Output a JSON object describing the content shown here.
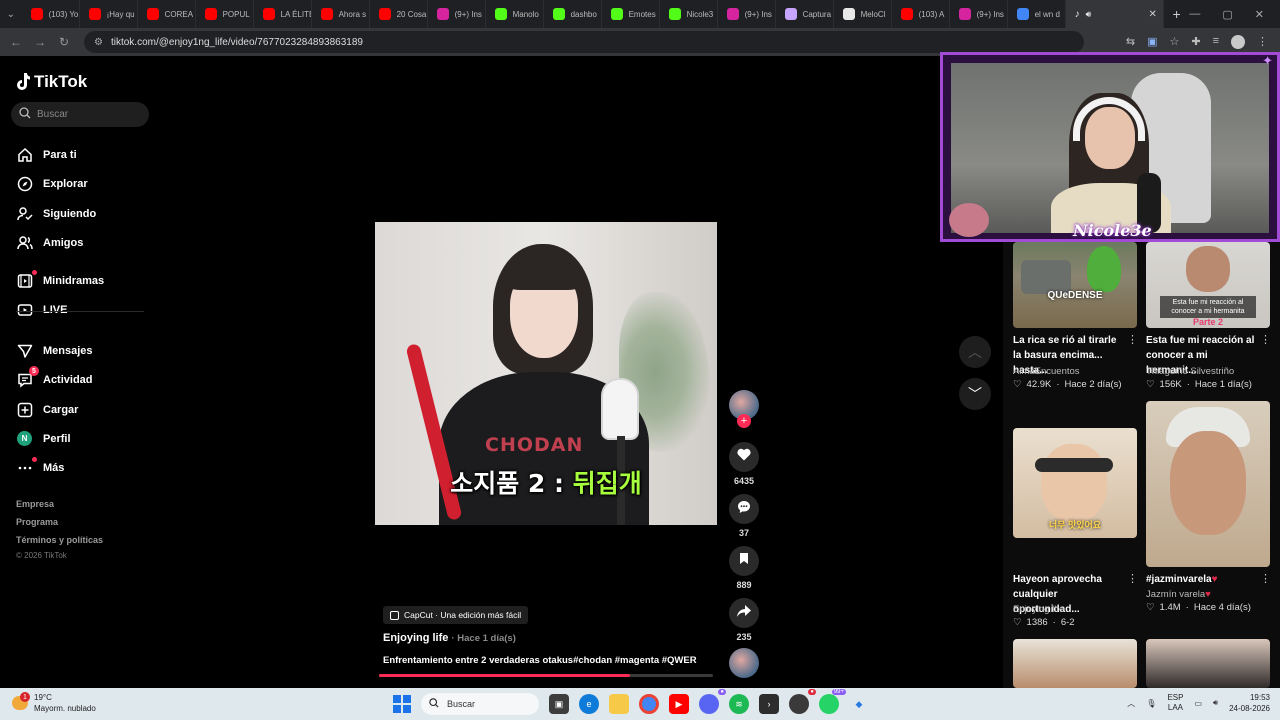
{
  "browser": {
    "tabs": [
      {
        "label": "(103) Yo",
        "icon": "youtube-icon",
        "color": "#ff0000"
      },
      {
        "label": "¡Hay qu",
        "icon": "youtube-icon",
        "color": "#ff0000"
      },
      {
        "label": "COREA",
        "icon": "youtube-icon",
        "color": "#ff0000"
      },
      {
        "label": "POPUL",
        "icon": "youtube-icon",
        "color": "#ff0000"
      },
      {
        "label": "LA ÉLITE",
        "icon": "youtube-icon",
        "color": "#ff0000"
      },
      {
        "label": "Ahora s",
        "icon": "youtube-icon",
        "color": "#ff0000"
      },
      {
        "label": "20 Cosa",
        "icon": "youtube-icon",
        "color": "#ff0000"
      },
      {
        "label": "(9+) Ins",
        "icon": "instagram-icon",
        "color": "#d6249f"
      },
      {
        "label": "Manolo",
        "icon": "kick-icon",
        "color": "#53fc18"
      },
      {
        "label": "dashbo",
        "icon": "kick-icon",
        "color": "#53fc18"
      },
      {
        "label": "Emotes",
        "icon": "kick-icon",
        "color": "#53fc18"
      },
      {
        "label": "Nicole3",
        "icon": "kick-icon",
        "color": "#53fc18"
      },
      {
        "label": "(9+) Ins",
        "icon": "instagram-icon",
        "color": "#d6249f"
      },
      {
        "label": "Captura",
        "icon": "pen-icon",
        "color": "#c6a4ff"
      },
      {
        "label": "MeloCl",
        "icon": "mail-icon",
        "color": "#e8e8e8"
      },
      {
        "label": "(103) A",
        "icon": "youtube-icon",
        "color": "#ff0000"
      },
      {
        "label": "(9+) Ins",
        "icon": "instagram-icon",
        "color": "#d6249f"
      },
      {
        "label": "el wn d",
        "icon": "google-icon",
        "color": "#4285f4"
      }
    ],
    "active_tab_icon": "tiktok-icon",
    "url": "tiktok.com/@enjoy1ng_life/video/7677023284893863189"
  },
  "sidebar": {
    "brand": "TikTok",
    "search_placeholder": "Buscar",
    "nav": [
      {
        "label": "Para ti",
        "icon": "home-icon"
      },
      {
        "label": "Explorar",
        "icon": "compass-icon"
      },
      {
        "label": "Siguiendo",
        "icon": "following-icon"
      },
      {
        "label": "Amigos",
        "icon": "friends-icon"
      },
      {
        "label": "Minidramas",
        "icon": "minidramas-icon"
      },
      {
        "label": "LIVE",
        "icon": "live-icon"
      },
      {
        "label": "Mensajes",
        "icon": "messages-icon"
      },
      {
        "label": "Actividad",
        "icon": "activity-icon",
        "badge": "5"
      },
      {
        "label": "Cargar",
        "icon": "upload-icon"
      },
      {
        "label": "Perfil",
        "icon": "profile-avatar",
        "avatar_letter": "N"
      },
      {
        "label": "Más",
        "icon": "more-icon"
      }
    ],
    "footer": [
      "Empresa",
      "Programa",
      "Términos y políticas"
    ],
    "copyright": "© 2026 TikTok"
  },
  "video": {
    "caption_white": "소지품 2 :",
    "caption_green": "뒤집개",
    "shirt_print": "CHODAN",
    "capcut_label": "CapCut · Una edición más fácil",
    "author": "Enjoying life",
    "posted": "· Hace 1 día(s)",
    "description": "Enfrentamiento entre 2 verdaderas otakus#chodan #magenta #QWER",
    "progress": 0.75,
    "likes": "6435",
    "comments": "37",
    "saves": "889",
    "shares": "235"
  },
  "recommendations": [
    {
      "title": "La rica se rió al tirarle la basura encima... hasta...",
      "author": "AlmaEncuentos",
      "likes": "42.9K",
      "when": "Hace 2 día(s)",
      "thumb_text": "QUeDENSE"
    },
    {
      "title": "Esta fue mi reacción al conocer a mi hermanit...",
      "author": "Thiaguiño Silvestriño",
      "likes": "156K",
      "when": "Hace 1 día(s)",
      "thumb_text": "Esta fue mi reacción al conocer a mi hermanita",
      "thumb_sub": "Parte 2"
    },
    {
      "title": "Hayeon aprovecha cualquier oportunidad...",
      "author": "Enjoying life",
      "likes": "1386",
      "when": "6-2",
      "thumb_text": "너무 맛있어요"
    },
    {
      "title": "#jazminvarela",
      "author": "Jazmín varela",
      "likes": "1.4M",
      "when": "Hace 4 día(s)"
    }
  ],
  "stream": {
    "name": "Nicole3e"
  },
  "taskbar": {
    "temp": "19°C",
    "weather": "Mayorm. nublado",
    "weather_badge": "1",
    "search": "Buscar",
    "lang1": "ESP",
    "lang2": "LAA",
    "time": "19:53",
    "date": "24-08-2026",
    "badge_99": "99+"
  }
}
